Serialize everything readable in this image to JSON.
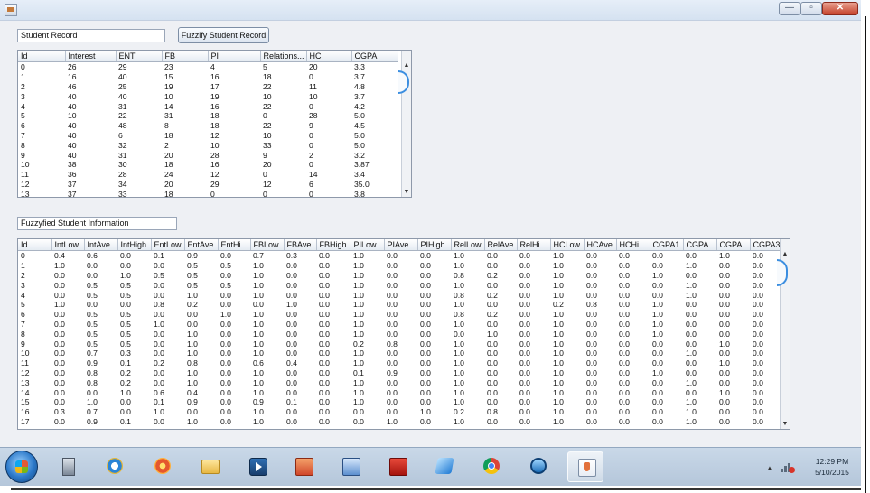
{
  "window": {
    "minimize": "—",
    "maximize": "▫",
    "close": "✕"
  },
  "student_record": {
    "title": "Student Record",
    "button": "Fuzzify Student Record",
    "columns": [
      "Id",
      "Interest",
      "ENT",
      "FB",
      "PI",
      "Relations...",
      "HC",
      "CGPA"
    ],
    "rows": [
      [
        "0",
        "26",
        "29",
        "23",
        "4",
        "5",
        "20",
        "3.3"
      ],
      [
        "1",
        "16",
        "40",
        "15",
        "16",
        "18",
        "0",
        "3.7"
      ],
      [
        "2",
        "46",
        "25",
        "19",
        "17",
        "22",
        "11",
        "4.8"
      ],
      [
        "3",
        "40",
        "40",
        "10",
        "19",
        "10",
        "10",
        "3.7"
      ],
      [
        "4",
        "40",
        "31",
        "14",
        "16",
        "22",
        "0",
        "4.2"
      ],
      [
        "5",
        "10",
        "22",
        "31",
        "18",
        "0",
        "28",
        "5.0"
      ],
      [
        "6",
        "40",
        "48",
        "8",
        "18",
        "22",
        "9",
        "4.5"
      ],
      [
        "7",
        "40",
        "6",
        "18",
        "12",
        "10",
        "0",
        "5.0"
      ],
      [
        "8",
        "40",
        "32",
        "2",
        "10",
        "33",
        "0",
        "5.0"
      ],
      [
        "9",
        "40",
        "31",
        "20",
        "28",
        "9",
        "2",
        "3.2"
      ],
      [
        "10",
        "38",
        "30",
        "18",
        "16",
        "20",
        "0",
        "3.87"
      ],
      [
        "11",
        "36",
        "28",
        "24",
        "12",
        "0",
        "14",
        "3.4"
      ],
      [
        "12",
        "37",
        "34",
        "20",
        "29",
        "12",
        "6",
        "35.0"
      ],
      [
        "13",
        "37",
        "33",
        "18",
        "0",
        "0",
        "0",
        "3.8"
      ]
    ]
  },
  "fuzzy_info": {
    "title": "Fuzzyfied Student Information",
    "columns": [
      "Id",
      "IntLow",
      "IntAve",
      "IntHigh",
      "EntLow",
      "EntAve",
      "EntHi...",
      "FBLow",
      "FBAve",
      "FBHigh",
      "PILow",
      "PIAve",
      "PIHigh",
      "RelLow",
      "RelAve",
      "RelHi...",
      "HCLow",
      "HCAve",
      "HCHi...",
      "CGPA1",
      "CGPA...",
      "CGPA...",
      "CGPA3"
    ],
    "rows": [
      [
        "0",
        "0.4",
        "0.6",
        "0.0",
        "0.1",
        "0.9",
        "0.0",
        "0.7",
        "0.3",
        "0.0",
        "1.0",
        "0.0",
        "0.0",
        "1.0",
        "0.0",
        "0.0",
        "1.0",
        "0.0",
        "0.0",
        "0.0",
        "0.0",
        "1.0",
        "0.0"
      ],
      [
        "1",
        "1.0",
        "0.0",
        "0.0",
        "0.0",
        "0.5",
        "0.5",
        "1.0",
        "0.0",
        "0.0",
        "1.0",
        "0.0",
        "0.0",
        "1.0",
        "0.0",
        "0.0",
        "1.0",
        "0.0",
        "0.0",
        "0.0",
        "1.0",
        "0.0",
        "0.0"
      ],
      [
        "2",
        "0.0",
        "0.0",
        "1.0",
        "0.5",
        "0.5",
        "0.0",
        "1.0",
        "0.0",
        "0.0",
        "1.0",
        "0.0",
        "0.0",
        "0.8",
        "0.2",
        "0.0",
        "1.0",
        "0.0",
        "0.0",
        "1.0",
        "0.0",
        "0.0",
        "0.0"
      ],
      [
        "3",
        "0.0",
        "0.5",
        "0.5",
        "0.0",
        "0.5",
        "0.5",
        "1.0",
        "0.0",
        "0.0",
        "1.0",
        "0.0",
        "0.0",
        "1.0",
        "0.0",
        "0.0",
        "1.0",
        "0.0",
        "0.0",
        "0.0",
        "1.0",
        "0.0",
        "0.0"
      ],
      [
        "4",
        "0.0",
        "0.5",
        "0.5",
        "0.0",
        "1.0",
        "0.0",
        "1.0",
        "0.0",
        "0.0",
        "1.0",
        "0.0",
        "0.0",
        "0.8",
        "0.2",
        "0.0",
        "1.0",
        "0.0",
        "0.0",
        "0.0",
        "1.0",
        "0.0",
        "0.0"
      ],
      [
        "5",
        "1.0",
        "0.0",
        "0.0",
        "0.8",
        "0.2",
        "0.0",
        "0.0",
        "1.0",
        "0.0",
        "1.0",
        "0.0",
        "0.0",
        "1.0",
        "0.0",
        "0.0",
        "0.2",
        "0.8",
        "0.0",
        "1.0",
        "0.0",
        "0.0",
        "0.0"
      ],
      [
        "6",
        "0.0",
        "0.5",
        "0.5",
        "0.0",
        "0.0",
        "1.0",
        "1.0",
        "0.0",
        "0.0",
        "1.0",
        "0.0",
        "0.0",
        "0.8",
        "0.2",
        "0.0",
        "1.0",
        "0.0",
        "0.0",
        "1.0",
        "0.0",
        "0.0",
        "0.0"
      ],
      [
        "7",
        "0.0",
        "0.5",
        "0.5",
        "1.0",
        "0.0",
        "0.0",
        "1.0",
        "0.0",
        "0.0",
        "1.0",
        "0.0",
        "0.0",
        "1.0",
        "0.0",
        "0.0",
        "1.0",
        "0.0",
        "0.0",
        "1.0",
        "0.0",
        "0.0",
        "0.0"
      ],
      [
        "8",
        "0.0",
        "0.5",
        "0.5",
        "0.0",
        "1.0",
        "0.0",
        "1.0",
        "0.0",
        "0.0",
        "1.0",
        "0.0",
        "0.0",
        "0.0",
        "1.0",
        "0.0",
        "1.0",
        "0.0",
        "0.0",
        "1.0",
        "0.0",
        "0.0",
        "0.0"
      ],
      [
        "9",
        "0.0",
        "0.5",
        "0.5",
        "0.0",
        "1.0",
        "0.0",
        "1.0",
        "0.0",
        "0.0",
        "0.2",
        "0.8",
        "0.0",
        "1.0",
        "0.0",
        "0.0",
        "1.0",
        "0.0",
        "0.0",
        "0.0",
        "0.0",
        "1.0",
        "0.0"
      ],
      [
        "10",
        "0.0",
        "0.7",
        "0.3",
        "0.0",
        "1.0",
        "0.0",
        "1.0",
        "0.0",
        "0.0",
        "1.0",
        "0.0",
        "0.0",
        "1.0",
        "0.0",
        "0.0",
        "1.0",
        "0.0",
        "0.0",
        "0.0",
        "1.0",
        "0.0",
        "0.0"
      ],
      [
        "11",
        "0.0",
        "0.9",
        "0.1",
        "0.2",
        "0.8",
        "0.0",
        "0.6",
        "0.4",
        "0.0",
        "1.0",
        "0.0",
        "0.0",
        "1.0",
        "0.0",
        "0.0",
        "1.0",
        "0.0",
        "0.0",
        "0.0",
        "0.0",
        "1.0",
        "0.0"
      ],
      [
        "12",
        "0.0",
        "0.8",
        "0.2",
        "0.0",
        "1.0",
        "0.0",
        "1.0",
        "0.0",
        "0.0",
        "0.1",
        "0.9",
        "0.0",
        "1.0",
        "0.0",
        "0.0",
        "1.0",
        "0.0",
        "0.0",
        "1.0",
        "0.0",
        "0.0",
        "0.0"
      ],
      [
        "13",
        "0.0",
        "0.8",
        "0.2",
        "0.0",
        "1.0",
        "0.0",
        "1.0",
        "0.0",
        "0.0",
        "1.0",
        "0.0",
        "0.0",
        "1.0",
        "0.0",
        "0.0",
        "1.0",
        "0.0",
        "0.0",
        "0.0",
        "1.0",
        "0.0",
        "0.0"
      ],
      [
        "14",
        "0.0",
        "0.0",
        "1.0",
        "0.6",
        "0.4",
        "0.0",
        "1.0",
        "0.0",
        "0.0",
        "1.0",
        "0.0",
        "0.0",
        "1.0",
        "0.0",
        "0.0",
        "1.0",
        "0.0",
        "0.0",
        "0.0",
        "0.0",
        "1.0",
        "0.0"
      ],
      [
        "15",
        "0.0",
        "1.0",
        "0.0",
        "0.1",
        "0.9",
        "0.0",
        "0.9",
        "0.1",
        "0.0",
        "1.0",
        "0.0",
        "0.0",
        "1.0",
        "0.0",
        "0.0",
        "1.0",
        "0.0",
        "0.0",
        "0.0",
        "1.0",
        "0.0",
        "0.0"
      ],
      [
        "16",
        "0.3",
        "0.7",
        "0.0",
        "1.0",
        "0.0",
        "0.0",
        "1.0",
        "0.0",
        "0.0",
        "0.0",
        "0.0",
        "1.0",
        "0.2",
        "0.8",
        "0.0",
        "1.0",
        "0.0",
        "0.0",
        "0.0",
        "1.0",
        "0.0",
        "0.0"
      ],
      [
        "17",
        "0.0",
        "0.9",
        "0.1",
        "0.0",
        "1.0",
        "0.0",
        "1.0",
        "0.0",
        "0.0",
        "0.0",
        "1.0",
        "0.0",
        "1.0",
        "0.0",
        "0.0",
        "1.0",
        "0.0",
        "0.0",
        "0.0",
        "1.0",
        "0.0",
        "0.0"
      ]
    ]
  },
  "taskbar": {
    "apps": [
      "explorer-icon",
      "internet-explorer-icon",
      "media-center-icon",
      "folder-icon",
      "media-player-icon",
      "powerpoint-icon",
      "publisher-icon",
      "acrobat-icon",
      "app-blue-icon",
      "chrome-icon",
      "cube-app-icon",
      "java-app-icon"
    ],
    "clock_time": "12:29 PM",
    "clock_date": "5/10/2015"
  }
}
